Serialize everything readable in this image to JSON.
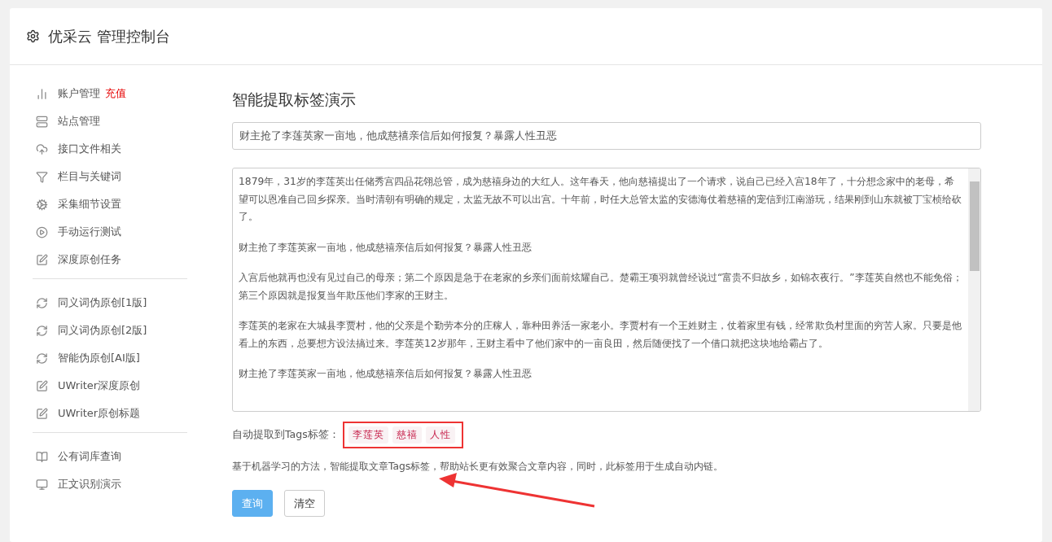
{
  "header": {
    "title": "优采云 管理控制台"
  },
  "sidebar": {
    "groups": [
      {
        "items": [
          {
            "label": "账户管理",
            "badge": "充值",
            "kind": "chart"
          },
          {
            "label": "站点管理",
            "kind": "server"
          },
          {
            "label": "接口文件相关",
            "kind": "cloud"
          },
          {
            "label": "栏目与关键词",
            "kind": "filter"
          },
          {
            "label": "采集细节设置",
            "kind": "gears"
          },
          {
            "label": "手动运行测试",
            "kind": "play"
          },
          {
            "label": "深度原创任务",
            "kind": "edit"
          }
        ]
      },
      {
        "items": [
          {
            "label": "同义词伪原创[1版]",
            "kind": "refresh"
          },
          {
            "label": "同义词伪原创[2版]",
            "kind": "refresh"
          },
          {
            "label": "智能伪原创[AI版]",
            "kind": "refresh"
          },
          {
            "label": "UWriter深度原创",
            "kind": "edit"
          },
          {
            "label": "UWriter原创标题",
            "kind": "edit"
          }
        ]
      },
      {
        "items": [
          {
            "label": "公有词库查询",
            "kind": "book"
          },
          {
            "label": "正文识别演示",
            "kind": "monitor"
          }
        ]
      }
    ]
  },
  "main": {
    "title": "智能提取标签演示",
    "title_field": {
      "value": "财主抢了李莲英家一亩地，他成慈禧亲信后如何报复？暴露人性丑恶"
    },
    "content_field": {
      "paragraphs": [
        "1879年，31岁的李莲英出任储秀宫四品花翎总管，成为慈禧身边的大红人。这年春天，他向慈禧提出了一个请求，说自己已经入宫18年了，十分想念家中的老母，希望可以恩准自己回乡探亲。当时清朝有明确的规定，太监无故不可以出宫。十年前，时任大总管太监的安德海仗着慈禧的宠信到江南游玩，结果刚到山东就被丁宝桢给砍了。",
        "财主抢了李莲英家一亩地，他成慈禧亲信后如何报复？暴露人性丑恶",
        "入宫后他就再也没有见过自己的母亲；第二个原因是急于在老家的乡亲们面前炫耀自己。楚霸王项羽就曾经说过“富贵不归故乡，如锦衣夜行。”李莲英自然也不能免俗；第三个原因就是报复当年欺压他们李家的王财主。",
        "李莲英的老家在大城县李贾村，他的父亲是个勤劳本分的庄稼人，靠种田养活一家老小。李贾村有一个王姓财主，仗着家里有钱，经常欺负村里面的穷苦人家。只要是他看上的东西，总要想方设法搞过来。李莲英12岁那年，王财主看中了他们家中的一亩良田，然后随便找了一个借口就把这块地给霸占了。",
        "财主抢了李莲英家一亩地，他成慈禧亲信后如何报复？暴露人性丑恶"
      ]
    },
    "tags_label": "自动提取到Tags标签：",
    "tags": [
      "李莲英",
      "慈禧",
      "人性"
    ],
    "description": "基于机器学习的方法，智能提取文章Tags标签，帮助站长更有效聚合文章内容，同时，此标签用于生成自动内链。",
    "buttons": [
      {
        "label": "查询",
        "kind": "primary"
      },
      {
        "label": "清空",
        "kind": "default"
      }
    ]
  }
}
